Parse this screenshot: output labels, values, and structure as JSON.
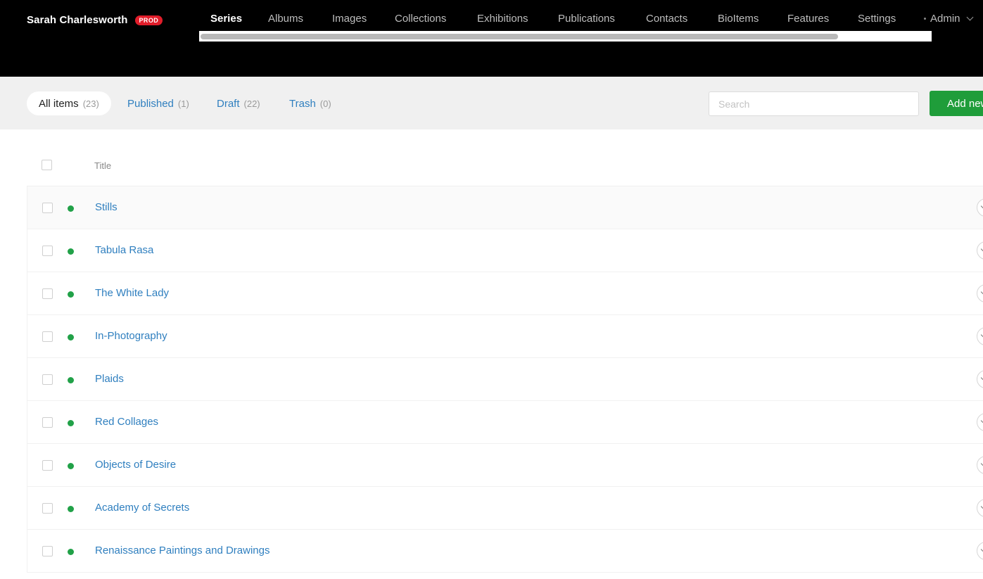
{
  "brand": {
    "name": "Sarah Charlesworth",
    "env_badge": "PROD"
  },
  "nav": {
    "items": [
      {
        "label": "Series",
        "active": true
      },
      {
        "label": "Albums"
      },
      {
        "label": "Images"
      },
      {
        "label": "Collections"
      },
      {
        "label": "Exhibitions"
      },
      {
        "label": "Publications"
      },
      {
        "label": "Contacts"
      },
      {
        "label": "BioItems"
      },
      {
        "label": "Features"
      },
      {
        "label": "Settings"
      }
    ],
    "admin_label": "Admin"
  },
  "filters": {
    "tabs": [
      {
        "label": "All items",
        "count": "(23)",
        "active": true
      },
      {
        "label": "Published",
        "count": "(1)"
      },
      {
        "label": "Draft",
        "count": "(22)"
      },
      {
        "label": "Trash",
        "count": "(0)"
      }
    ],
    "search_placeholder": "Search",
    "add_button_label": "Add new"
  },
  "table": {
    "column_title": "Title",
    "rows": [
      {
        "title": "Stills",
        "status": "published"
      },
      {
        "title": "Tabula Rasa",
        "status": "published"
      },
      {
        "title": "The White Lady",
        "status": "published"
      },
      {
        "title": "In-Photography",
        "status": "published"
      },
      {
        "title": "Plaids",
        "status": "published"
      },
      {
        "title": "Red Collages",
        "status": "published"
      },
      {
        "title": "Objects of Desire",
        "status": "published"
      },
      {
        "title": "Academy of Secrets",
        "status": "published"
      },
      {
        "title": "Renaissance Paintings and Drawings",
        "status": "published"
      }
    ]
  },
  "colors": {
    "accent": "#2f7fbf",
    "status_published": "#21a148",
    "add_button": "#1f9d3a",
    "env_badge": "#e11d2a"
  }
}
